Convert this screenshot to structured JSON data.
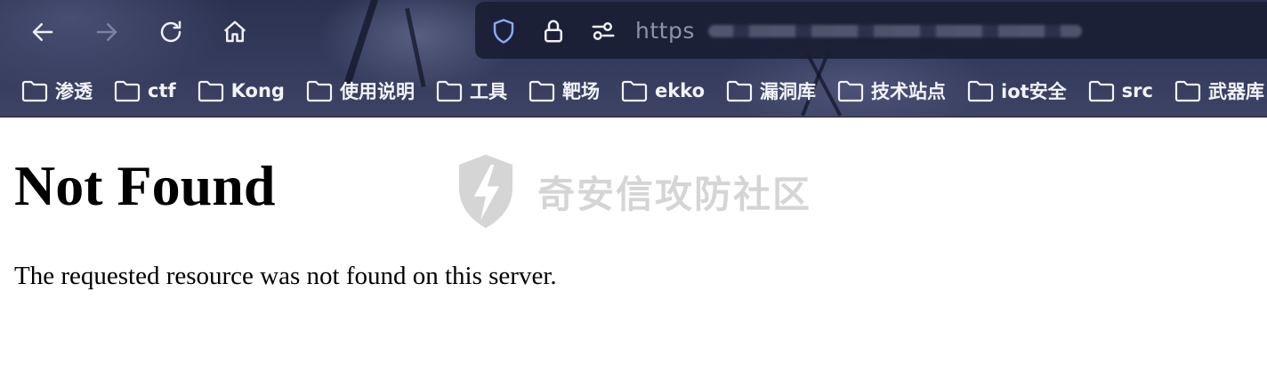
{
  "browser": {
    "url_scheme": "https",
    "colors": {
      "chrome_bg": "#353b5c",
      "urlbar_bg": "#1a1e34",
      "icon": "#f0f0f5",
      "icon_disabled": "#7c81a0",
      "shield": "#8aa8ff"
    },
    "toolbar": {
      "back_icon": "arrow-left-icon",
      "forward_icon": "arrow-right-icon",
      "reload_icon": "reload-icon",
      "home_icon": "home-icon"
    },
    "urlbar_icons": [
      "shield-icon",
      "lock-icon",
      "permissions-icon"
    ],
    "bookmarks": [
      {
        "label": "渗透"
      },
      {
        "label": "ctf"
      },
      {
        "label": "Kong"
      },
      {
        "label": "使用说明"
      },
      {
        "label": "工具"
      },
      {
        "label": "靶场"
      },
      {
        "label": "ekko"
      },
      {
        "label": "漏洞库"
      },
      {
        "label": "技术站点"
      },
      {
        "label": "iot安全"
      },
      {
        "label": "src"
      },
      {
        "label": "武器库"
      }
    ]
  },
  "page": {
    "heading": "Not Found",
    "message": "The requested resource was not found on this server.",
    "watermark": {
      "text": "奇安信攻防社区",
      "icon": "lightning-shield-icon"
    }
  }
}
